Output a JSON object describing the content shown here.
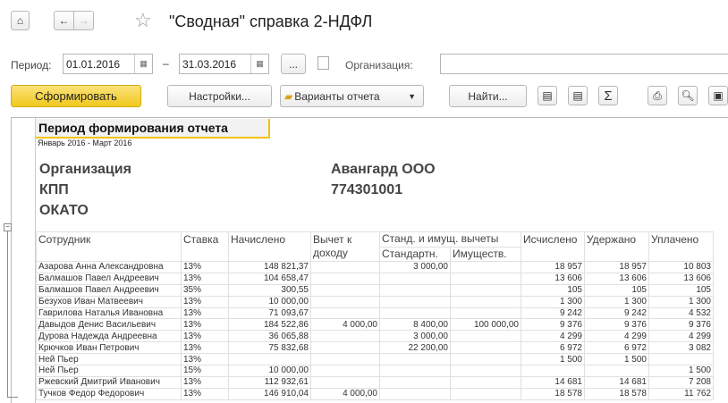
{
  "window": {
    "title": "\"Сводная\" справка 2-НДФЛ"
  },
  "nav": {
    "home_icon": "home-icon",
    "back_icon": "arrow-left-icon",
    "forward_icon": "arrow-right-icon",
    "favorite_icon": "star-icon"
  },
  "filters": {
    "period_label": "Период:",
    "date_from": "01.01.2016",
    "date_to": "31.03.2016",
    "dash": "–",
    "more_label": "...",
    "org_label": "Организация:",
    "org_value": ""
  },
  "toolbar": {
    "generate": "Сформировать",
    "settings": "Настройки...",
    "variants": "Варианты отчета",
    "find": "Найти...",
    "sum_symbol": "Σ",
    "accent": "#f5d130"
  },
  "report": {
    "period_header": "Период формирования отчета",
    "period_value": "Январь 2016 - Март 2016",
    "org_label": "Организация",
    "org_value": "Авангард ООО",
    "kpp_label": "КПП",
    "kpp_value": "774301001",
    "okato_label": "ОКАТО",
    "columns": {
      "employee": "Сотрудник",
      "rate": "Ставка",
      "accrued": "Начислено",
      "deduction": "Вычет к доходу",
      "std_prop": "Станд. и имущ. вычеты",
      "standard": "Стандартн.",
      "property": "Имуществ.",
      "calculated": "Исчислено",
      "withheld": "Удержано",
      "paid": "Уплачено"
    },
    "rows": [
      [
        "Азарова Анна Александровна",
        "13%",
        "148 821,37",
        "",
        "3 000,00",
        "",
        "18 957",
        "18 957",
        "10 803"
      ],
      [
        "Балмашов Павел Андреевич",
        "13%",
        "104 658,47",
        "",
        "",
        "",
        "13 606",
        "13 606",
        "13 606"
      ],
      [
        "Балмашов Павел Андреевич",
        "35%",
        "300,55",
        "",
        "",
        "",
        "105",
        "105",
        "105"
      ],
      [
        "Безухов Иван Матвеевич",
        "13%",
        "10 000,00",
        "",
        "",
        "",
        "1 300",
        "1 300",
        "1 300"
      ],
      [
        "Гаврилова Наталья Ивановна",
        "13%",
        "71 093,67",
        "",
        "",
        "",
        "9 242",
        "9 242",
        "4 532"
      ],
      [
        "Давыдов Денис Васильевич",
        "13%",
        "184 522,86",
        "4 000,00",
        "8 400,00",
        "100 000,00",
        "9 376",
        "9 376",
        "9 376"
      ],
      [
        "Дурова Надежда Андреевна",
        "13%",
        "36 065,88",
        "",
        "3 000,00",
        "",
        "4 299",
        "4 299",
        "4 299"
      ],
      [
        "Крючков Иван Петрович",
        "13%",
        "75 832,68",
        "",
        "22 200,00",
        "",
        "6 972",
        "6 972",
        "3 082"
      ],
      [
        "Ней Пьер",
        "13%",
        "",
        "",
        "",
        "",
        "1 500",
        "1 500",
        ""
      ],
      [
        "Ней Пьер",
        "15%",
        "10 000,00",
        "",
        "",
        "",
        "",
        "",
        "1 500"
      ],
      [
        "Ржевский Дмитрий Иванович",
        "13%",
        "112 932,61",
        "",
        "",
        "",
        "14 681",
        "14 681",
        "7 208"
      ],
      [
        "Тучков Федор Федорович",
        "13%",
        "146 910,04",
        "4 000,00",
        "",
        "",
        "18 578",
        "18 578",
        "11 762"
      ]
    ]
  }
}
